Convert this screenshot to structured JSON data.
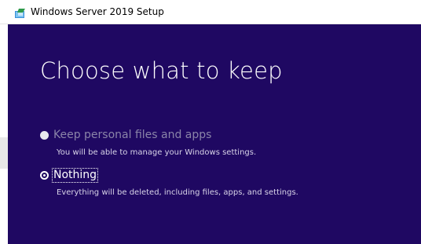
{
  "window": {
    "title": "Windows Server 2019 Setup",
    "icon": "setup-icon"
  },
  "page": {
    "heading": "Choose what to keep"
  },
  "options": [
    {
      "label": "Keep personal files and apps",
      "description": "You will be able to manage your Windows settings.",
      "enabled": false,
      "selected": false
    },
    {
      "label": "Nothing",
      "description": "Everything will be deleted, including files, apps, and settings.",
      "enabled": true,
      "selected": true
    }
  ],
  "colors": {
    "background": "#1f0862",
    "text": "#ffffff",
    "disabled_text": "#8a84a8"
  }
}
